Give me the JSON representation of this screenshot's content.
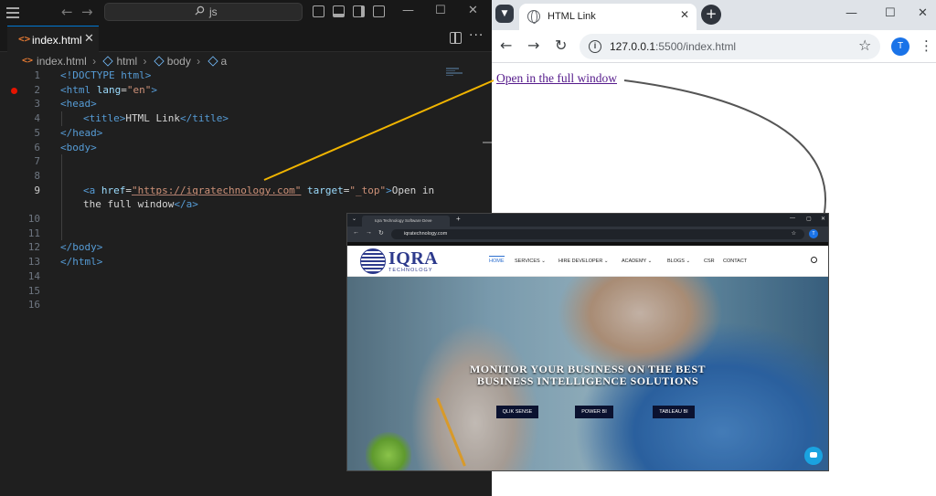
{
  "vscode": {
    "search_text": "js",
    "tab": {
      "icon": "<>",
      "filename": "index.html",
      "close": "✕"
    },
    "breadcrumb": [
      "index.html",
      "html",
      "body",
      "a"
    ],
    "line_numbers": [
      "1",
      "2",
      "3",
      "4",
      "5",
      "6",
      "7",
      "8",
      "9",
      "10",
      "11",
      "12",
      "13",
      "14",
      "15",
      "16"
    ],
    "active_line": "9",
    "code": {
      "l1_tag": "<!DOCTYPE html>",
      "l2_open": "<html ",
      "l2_attr": "lang",
      "l2_eq": "=",
      "l2_val": "\"en\"",
      "l2_close": ">",
      "l3": "<head>",
      "l4_open": "<title>",
      "l4_text": "HTML Link",
      "l4_close": "</title>",
      "l5": "</head>",
      "l6": "<body>",
      "l9_open": "<a ",
      "l9_href": "href",
      "l9_eq": "=",
      "l9_url": "\"https://iqratechnology.com\"",
      "l9_target": " target",
      "l9_eq2": "=",
      "l9_tval": "\"_top\"",
      "l9_gt": ">",
      "l9_text": "Open in",
      "l9b_text": "the full window",
      "l9b_close": "</a>",
      "l12": "</body>",
      "l13": "</html>"
    }
  },
  "chrome": {
    "tab_title": "HTML Link",
    "tab_close": "✕",
    "new_tab": "+",
    "url_host": "127.0.0.1",
    "url_path": ":5500/index.html",
    "profile_initial": "T",
    "page_link_text": "Open in the full window"
  },
  "inset": {
    "tab_title": "Iqra Technology Software Deve",
    "url": "iqratechnology.com",
    "profile_initial": "T",
    "logo_text": "IQRA",
    "logo_sub": "TECHNOLOGY",
    "menu": [
      "HOME",
      "SERVICES ⌄",
      "HIRE DEVELOPER ⌄",
      "ACADEMY ⌄",
      "BLOGS ⌄",
      "CSR",
      "CONTACT"
    ],
    "hero_line1": "MONITOR YOUR BUSINESS ON THE BEST",
    "hero_line2": "BUSINESS INTELLIGENCE SOLUTIONS",
    "buttons": [
      "QLIK SENSE",
      "POWER BI",
      "TABLEAU BI"
    ]
  },
  "colors": {
    "vscode_bg": "#1f1f1f",
    "tag": "#569cd6",
    "attr": "#9cdcfe",
    "string": "#ce9178",
    "visited_link": "#551a8b",
    "annotation_yellow": "#f0b400",
    "annotation_gray": "#555555"
  },
  "icons": [
    "hamburger-icon",
    "back-arrow-icon",
    "forward-arrow-icon",
    "search-icon",
    "layout-icon",
    "split-editor-icon",
    "more-icon",
    "globe-icon",
    "reload-icon",
    "info-icon",
    "star-icon",
    "kebab-menu-icon",
    "chat-icon"
  ]
}
